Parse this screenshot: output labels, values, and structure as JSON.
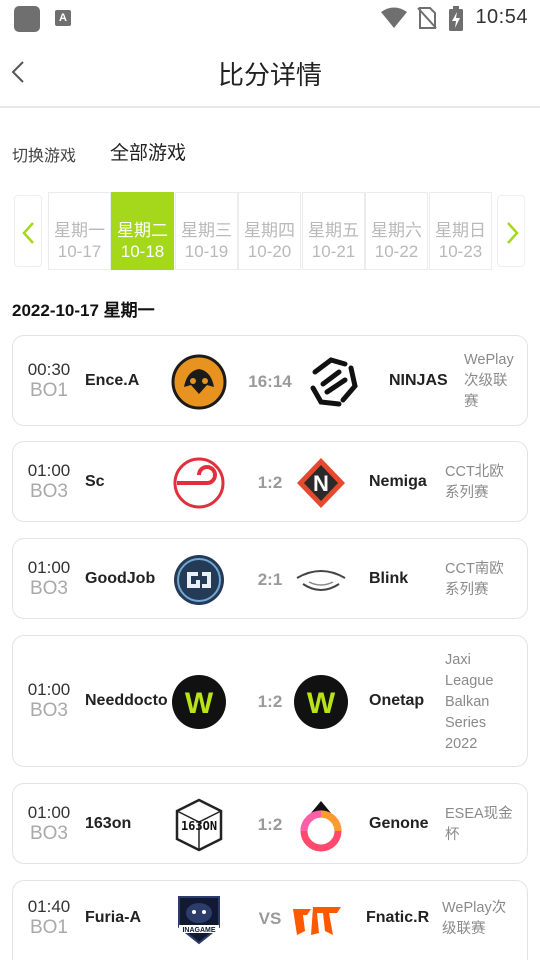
{
  "status_bar": {
    "time": "10:54",
    "a_badge": "A",
    "icons": [
      "app-icon",
      "a-icon",
      "wifi-icon",
      "no-sim-icon",
      "battery-charging-icon"
    ]
  },
  "header": {
    "title": "比分详情",
    "back_icon": "chevron-left-icon"
  },
  "game_switch": {
    "label": "切换游戏",
    "value": "全部游戏"
  },
  "accent_color": "#a5d81b",
  "dates": [
    {
      "weekday": "星期一",
      "date": "10-17",
      "active": false
    },
    {
      "weekday": "星期二",
      "date": "10-18",
      "active": true
    },
    {
      "weekday": "星期三",
      "date": "10-19",
      "active": false
    },
    {
      "weekday": "星期四",
      "date": "10-20",
      "active": false
    },
    {
      "weekday": "星期五",
      "date": "10-21",
      "active": false
    },
    {
      "weekday": "星期六",
      "date": "10-22",
      "active": false
    },
    {
      "weekday": "星期日",
      "date": "10-23",
      "active": false
    }
  ],
  "section_date": "2022-10-17 星期一",
  "matches": [
    {
      "time": "00:30",
      "bo": "BO1",
      "home": "Ence.A",
      "score": "16:14",
      "away": "NINJAS",
      "league": [
        "WePlay",
        "次级联",
        "赛"
      ],
      "home_logo": "ence-logo",
      "away_logo": "ninjas-logo"
    },
    {
      "time": "01:00",
      "bo": "BO3",
      "home": "Sc",
      "score": "1:2",
      "away": "Nemiga",
      "league": [
        "CCT北欧",
        "系列赛"
      ],
      "home_logo": "sc-logo",
      "away_logo": "nemiga-logo"
    },
    {
      "time": "01:00",
      "bo": "BO3",
      "home": "GoodJob",
      "score": "2:1",
      "away": "Blink",
      "league": [
        "CCT南欧",
        "系列赛"
      ],
      "home_logo": "goodjob-logo",
      "away_logo": "blink-logo"
    },
    {
      "time": "01:00",
      "bo": "BO3",
      "home": "Needdocto",
      "score": "1:2",
      "away": "Onetap",
      "league": [
        "Jaxi",
        "League",
        "Balkan",
        "Series",
        "2022"
      ],
      "home_logo": "w-logo",
      "away_logo": "w-logo"
    },
    {
      "time": "01:00",
      "bo": "BO3",
      "home": "163on",
      "score": "1:2",
      "away": "Genone",
      "league": [
        "ESEA现金",
        "杯"
      ],
      "home_logo": "163on-logo",
      "away_logo": "genone-logo"
    },
    {
      "time": "01:40",
      "bo": "BO1",
      "home": "Furia-A",
      "score": "VS",
      "away": "Fnatic.R",
      "league": [
        "WePlay次",
        "级联赛"
      ],
      "home_logo": "inagame-logo",
      "away_logo": "fnatic-logo"
    }
  ]
}
